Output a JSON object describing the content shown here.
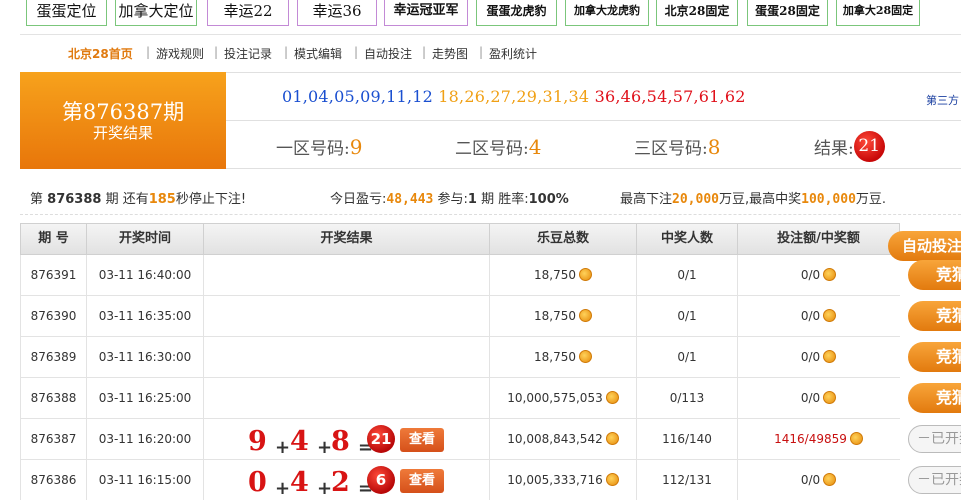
{
  "game_tabs": [
    {
      "label": "蛋蛋定位"
    },
    {
      "label": "加拿大定位"
    },
    {
      "label": "幸运22"
    },
    {
      "label": "幸运36"
    },
    {
      "label": "幸运冠亚军"
    },
    {
      "label": "蛋蛋龙虎豹"
    },
    {
      "label": "加拿大龙虎豹"
    },
    {
      "label": "北京28固定"
    },
    {
      "label": "蛋蛋28固定"
    },
    {
      "label": "加拿大28固定"
    }
  ],
  "subnav": [
    "北京28首页",
    "游戏规则",
    "投注记录",
    "模式编辑",
    "自动投注",
    "走势图",
    "盈利统计"
  ],
  "subnav_sep": "|",
  "header": {
    "period_title": "第876387期",
    "period_sub": "开奖结果",
    "numbers_blue": "01,04,05,09,11,12",
    "numbers_orange": "18,26,27,29,31,34",
    "numbers_red": "36,46,54,57,61,62",
    "third_link": "第三方",
    "zone1_label": "一区号码:",
    "zone1_value": "9",
    "zone2_label": "二区号码:",
    "zone2_value": "4",
    "zone3_label": "三区号码:",
    "zone3_value": "8",
    "result_label": "结果:",
    "result_value": "21"
  },
  "info": {
    "prefix": "第",
    "next_period": "876388",
    "period_suffix": "期 还有",
    "seconds": "185",
    "seconds_suffix": "秒停止下注!",
    "profit_label": "今日盈亏:",
    "profit_value": "48,443",
    "join_label": "参与:",
    "join_value": "1",
    "join_suffix": "期",
    "rate_label": "胜率:",
    "rate_value": "100%",
    "max_bet_label": "最高下注",
    "max_bet_value": "20,000",
    "max_bet_unit": "万豆,最高中奖",
    "max_win_value": "100,000",
    "max_win_unit": "万豆."
  },
  "table": {
    "headers": [
      "期 号",
      "开奖时间",
      "开奖结果",
      "乐豆总数",
      "中奖人数",
      "投注额/中奖额"
    ],
    "rows": [
      {
        "period": "876391",
        "time": "03-11 16:40:00",
        "total": "18,750",
        "winners": "0/1",
        "bet": "0/0",
        "win": false
      },
      {
        "period": "876390",
        "time": "03-11 16:35:00",
        "total": "18,750",
        "winners": "0/1",
        "bet": "0/0",
        "win": false
      },
      {
        "period": "876389",
        "time": "03-11 16:30:00",
        "total": "18,750",
        "winners": "0/1",
        "bet": "0/0",
        "win": false
      },
      {
        "period": "876388",
        "time": "03-11 16:25:00",
        "total": "10,000,575,053",
        "winners": "0/113",
        "bet": "0/0",
        "win": false
      },
      {
        "period": "876387",
        "time": "03-11 16:20:00",
        "total": "10,008,843,542",
        "winners": "116/140",
        "bet": "1416/49859",
        "win": true,
        "result": {
          "a": "9",
          "b": "4",
          "c": "8",
          "sum": "21"
        }
      },
      {
        "period": "876386",
        "time": "03-11 16:15:00",
        "total": "10,005,333,716",
        "winners": "112/131",
        "bet": "0/0",
        "win": false,
        "result": {
          "a": "0",
          "b": "4",
          "c": "2",
          "sum": "6"
        }
      }
    ],
    "view_label": "查看",
    "plus": "+",
    "equals": "="
  },
  "right": {
    "auto_label": "自动投注",
    "guess_label": "竞猜",
    "opened_label": "已开奖"
  }
}
